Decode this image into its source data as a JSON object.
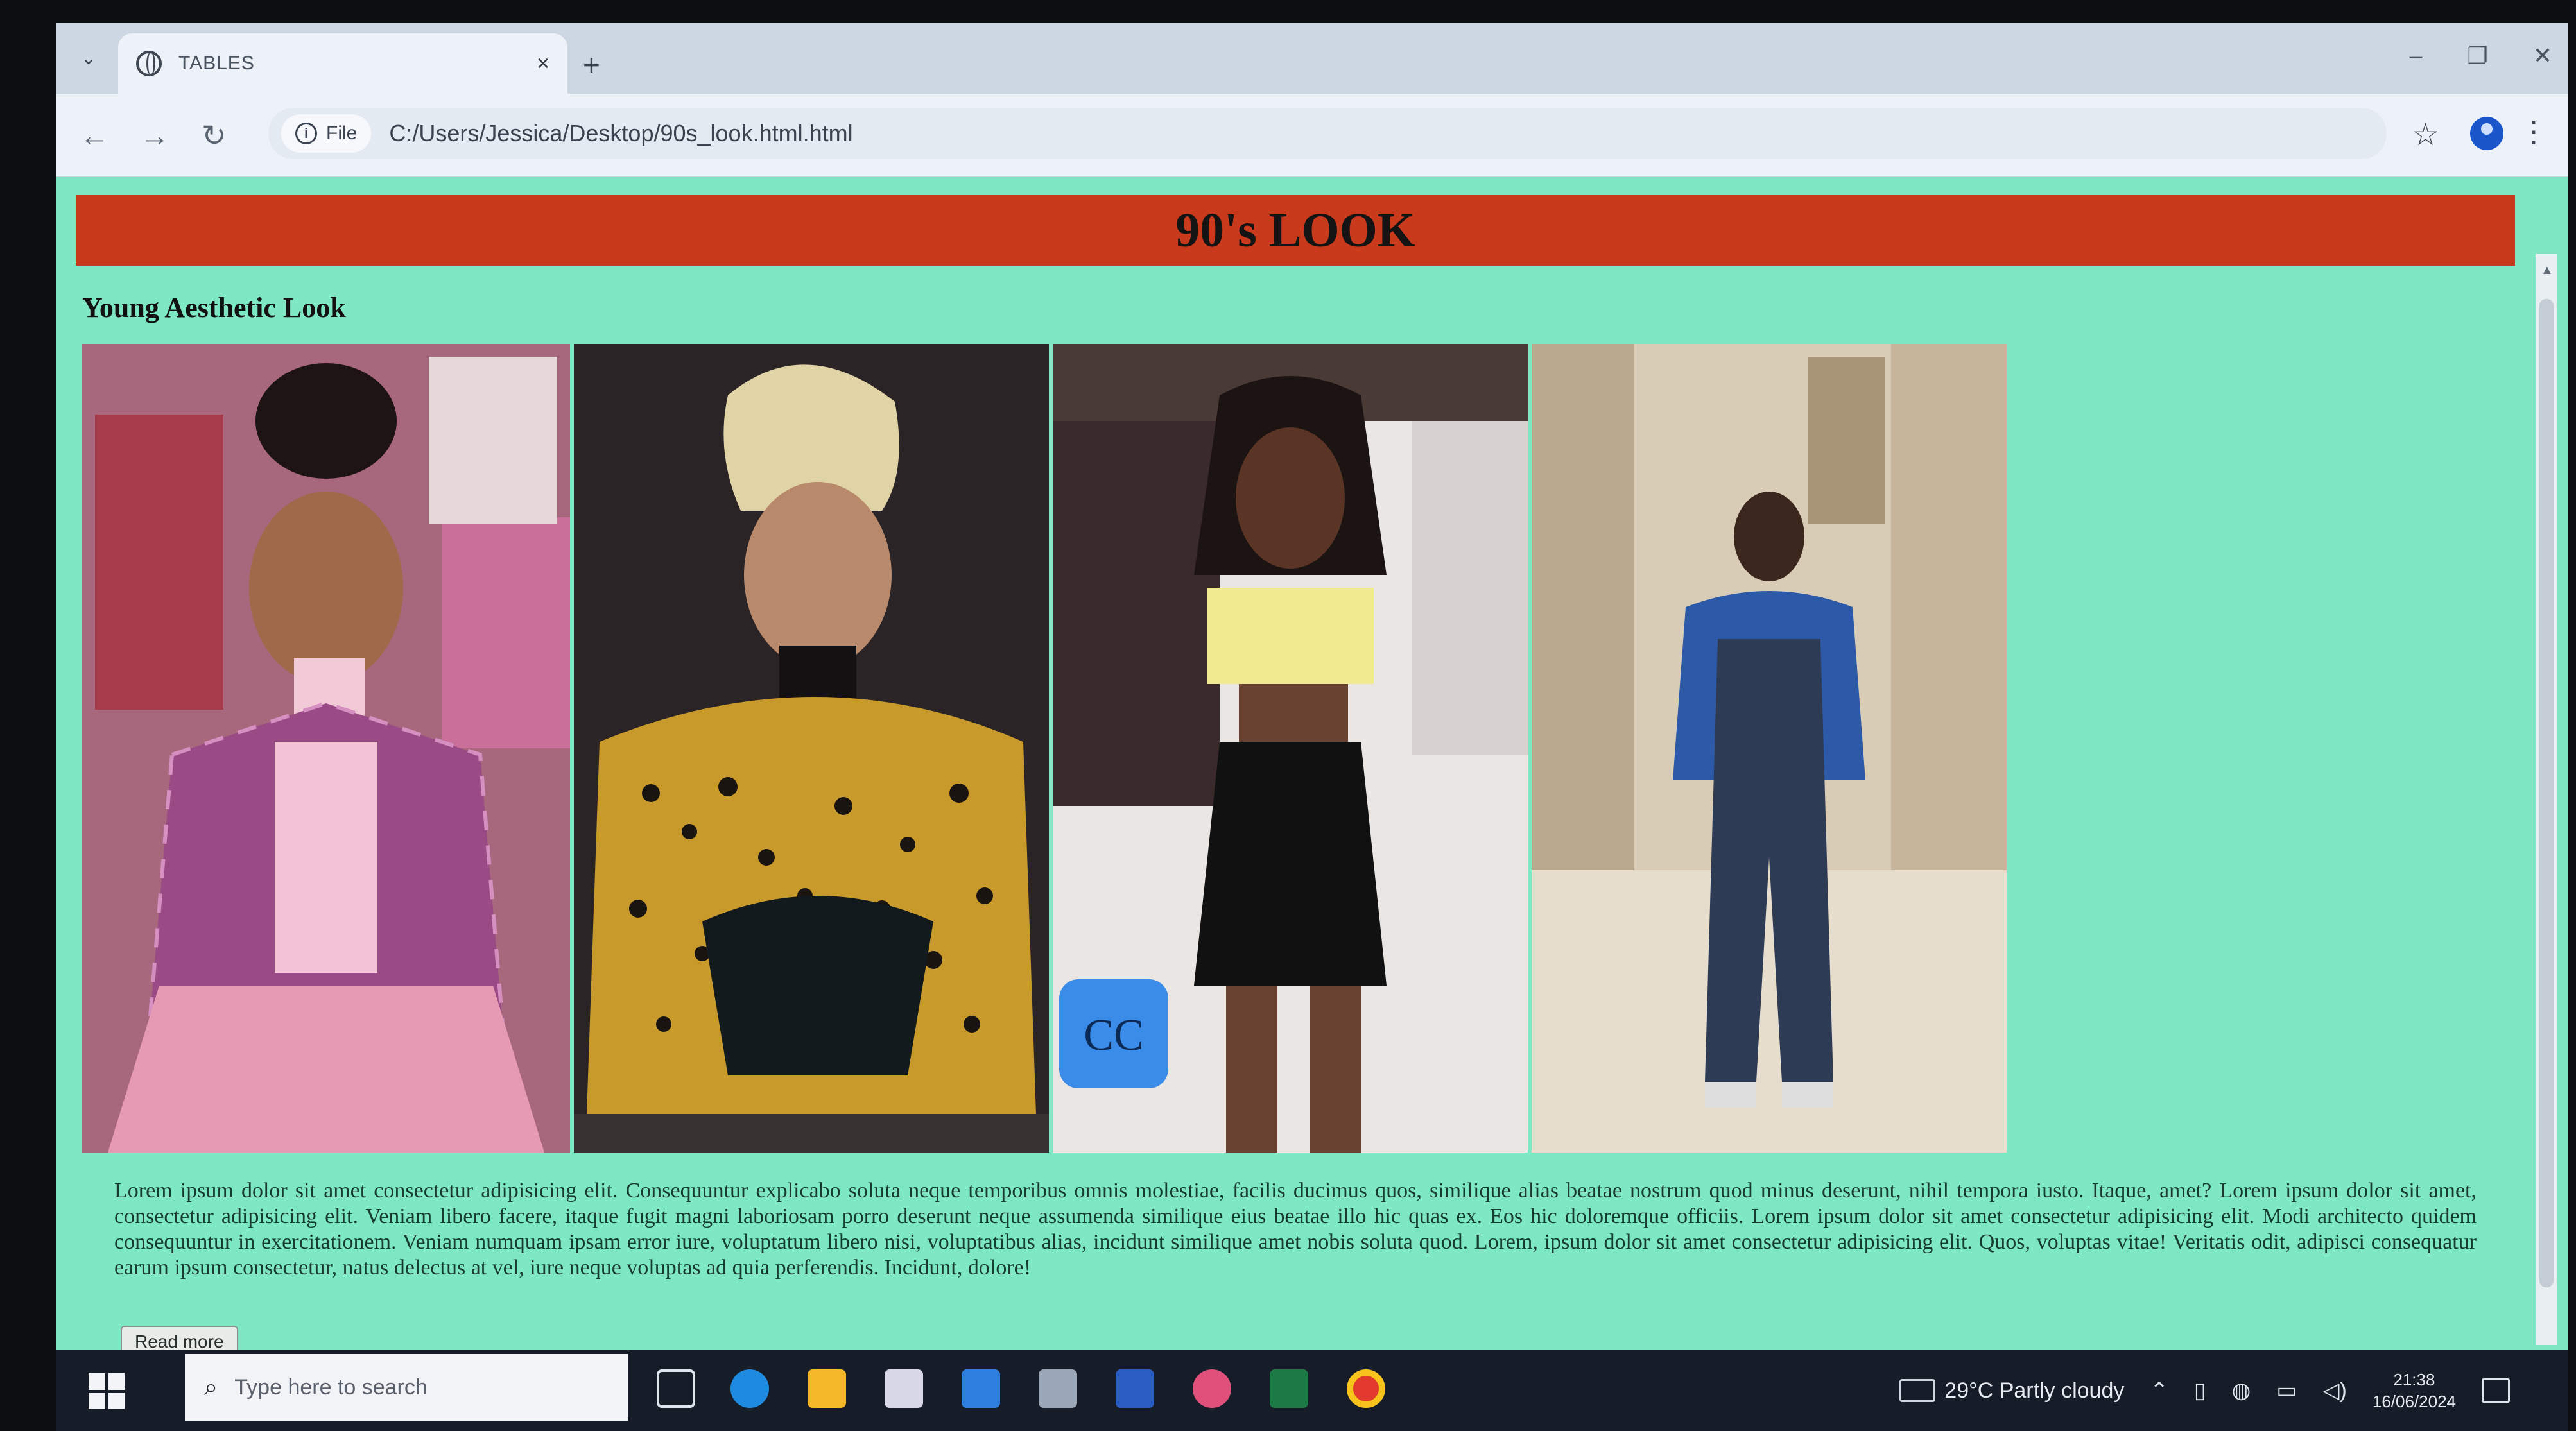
{
  "browser": {
    "tab_title": "TABLES",
    "new_tab_glyph": "+",
    "tab_close_glyph": "×",
    "file_chip_label": "File",
    "url": "C:/Users/Jessica/Desktop/90s_look.html.html",
    "window_controls": [
      "–",
      "❐",
      "✕"
    ]
  },
  "page": {
    "banner_title": "90's LOOK",
    "subheading": "Young Aesthetic Look",
    "paragraph": "Lorem ipsum dolor sit amet consectetur adipisicing elit. Consequuntur explicabo soluta neque temporibus omnis molestiae, facilis ducimus quos, similique alias beatae nostrum quod minus deserunt, nihil tempora iusto. Itaque, amet? Lorem ipsum dolor sit amet, consectetur adipisicing elit. Veniam libero facere, itaque fugit magni laboriosam porro deserunt neque assumenda similique eius beatae illo hic quas ex. Eos hic doloremque officiis. Lorem ipsum dolor sit amet consectetur adipisicing elit. Modi architecto quidem consequuntur in exercitationem. Veniam numquam ipsam error iure, voluptatum libero nisi, voluptatibus alias, incidunt similique amet nobis soluta quod. Lorem, ipsum dolor sit amet consectetur adipisicing elit. Quos, voluptas vitae! Veritatis odit, adipisci consequatur earum ipsum consectetur, natus delectus at vel, iure neque voluptas ad quia perferendis. Incidunt, dolore!",
    "read_more_label": "Read more",
    "colors": {
      "page_bg": "#7ee8c4",
      "banner_bg": "#c9391c"
    }
  },
  "taskbar": {
    "search_placeholder": "Type here to search",
    "weather": "29°C  Partly cloudy",
    "time": "21:38",
    "date": "16/06/2024",
    "pinned_icons": [
      "task-view-icon",
      "edge-icon",
      "file-explorer-icon",
      "store-icon",
      "mail-icon",
      "network-icon",
      "word-icon",
      "copilot-icon",
      "excel-icon",
      "chrome-icon"
    ]
  }
}
